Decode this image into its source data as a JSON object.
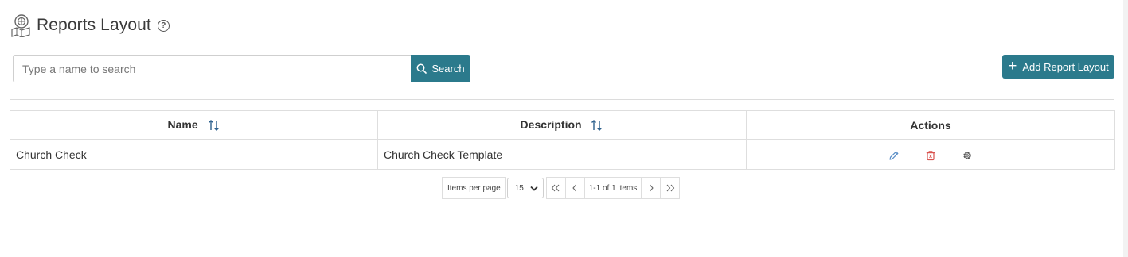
{
  "header": {
    "title": "Reports Layout",
    "help_glyph": "?"
  },
  "search": {
    "placeholder": "Type a name to search",
    "value": "",
    "button_label": "Search"
  },
  "add_button": {
    "label": "Add Report Layout"
  },
  "table": {
    "columns": [
      {
        "label": "Name",
        "sortable": true
      },
      {
        "label": "Description",
        "sortable": true
      },
      {
        "label": "Actions",
        "sortable": false
      }
    ],
    "rows": [
      {
        "name": "Church Check",
        "description": "Church Check Template"
      }
    ]
  },
  "pager": {
    "items_per_page_label": "Items per page",
    "items_per_page_value": "15",
    "info": "1-1 of 1 items"
  },
  "colors": {
    "accent": "#2b7a8c",
    "delete": "#d9534f",
    "edit": "#5b8fc7"
  }
}
